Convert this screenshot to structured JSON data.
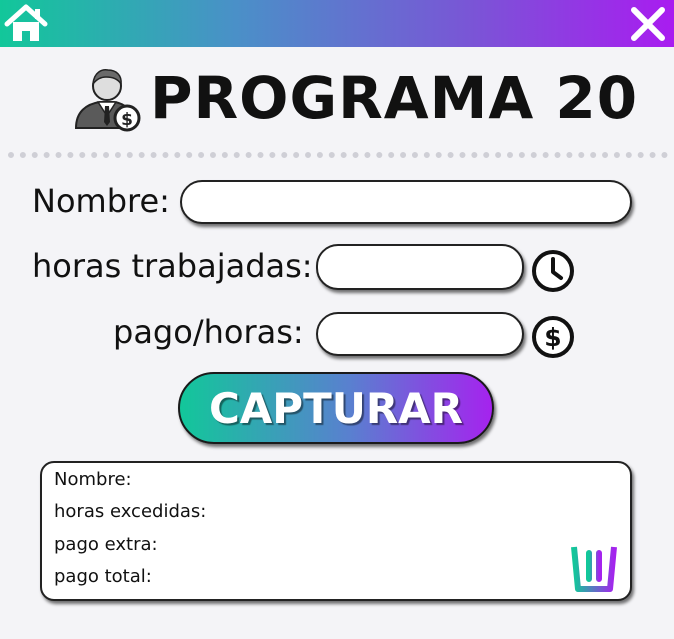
{
  "header": {
    "home_icon": "home-icon",
    "close_icon": "close-icon",
    "gradient_start": "#12c79a",
    "gradient_end": "#a91cf0"
  },
  "title": {
    "icon": "businessman-dollar-icon",
    "text": "PROGRAMA 20"
  },
  "form": {
    "nombre_label": "Nombre:",
    "nombre_value": "",
    "horas_label": "horas trabajadas:",
    "horas_value": "",
    "horas_icon": "clock-icon",
    "pago_label": "pago/horas:",
    "pago_value": "",
    "pago_icon": "dollar-circle-icon",
    "capture_label": "CAPTURAR"
  },
  "results": {
    "nombre": "Nombre:",
    "horas_excedidas": "horas excedidas:",
    "pago_extra": "pago extra:",
    "pago_total": "pago total:",
    "trash_icon": "trash-icon"
  }
}
